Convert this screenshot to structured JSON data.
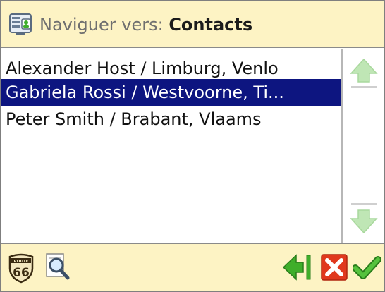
{
  "header": {
    "prefix": "Naviguer vers:",
    "destination": "Contacts",
    "icon": "contact-list-icon"
  },
  "list": {
    "items": [
      {
        "label": "Alexander Host / Limburg, Venlo",
        "selected": false
      },
      {
        "label": "Gabriela Rossi / Westvoorne, Ti...",
        "selected": true
      },
      {
        "label": "Peter Smith / Brabant, Vlaams",
        "selected": false
      }
    ]
  },
  "scrollbar": {
    "up_icon": "scroll-up-arrow-icon",
    "down_icon": "scroll-down-arrow-icon"
  },
  "footer": {
    "route_badge": {
      "top_text": "ROUTE",
      "number": "66"
    },
    "search_icon": "magnifier-icon",
    "back_icon": "back-arrow-icon",
    "cancel_icon": "cancel-x-icon",
    "ok_icon": "checkmark-icon"
  },
  "colors": {
    "bar_background": "#fdf3c4",
    "selection": "#0d1580",
    "green": "#3fae2a",
    "red": "#e0381d"
  }
}
